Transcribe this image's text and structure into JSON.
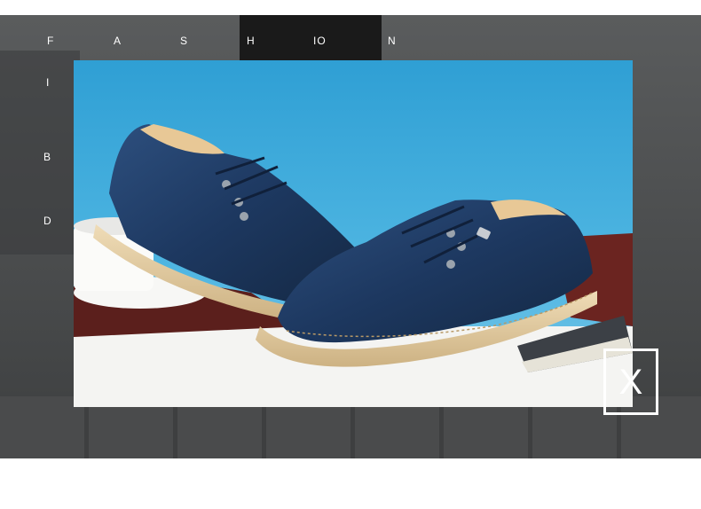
{
  "heading": {
    "letters": [
      "F",
      "A",
      "S",
      "H",
      "IO",
      "N"
    ]
  },
  "side": {
    "letters": [
      "I",
      "B",
      "D"
    ]
  },
  "close": {
    "label": "X"
  },
  "colors": {
    "sky": "#3fa8d8",
    "shoe": "#1e3a63",
    "sole": "#e4cfa6"
  }
}
